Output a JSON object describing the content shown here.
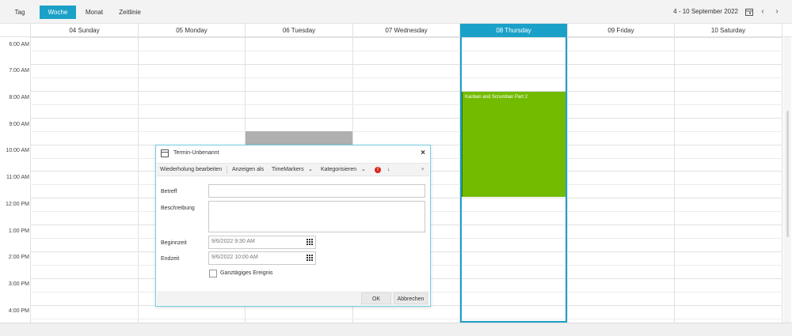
{
  "toolbar": {
    "views": [
      {
        "label": "Tag",
        "active": false
      },
      {
        "label": "Woche",
        "active": true
      },
      {
        "label": "Monat",
        "active": false
      },
      {
        "label": "Zeitlinie",
        "active": false
      }
    ],
    "date_range": "4 - 10 September 2022",
    "calendar_icon": "calendar-icon",
    "prev_icon": "chevron-left-icon",
    "next_icon": "chevron-right-icon",
    "prev_glyph": "‹",
    "next_glyph": "›"
  },
  "calendar": {
    "days": [
      {
        "label": "04 Sunday",
        "today": false
      },
      {
        "label": "05 Monday",
        "today": false
      },
      {
        "label": "06 Tuesday",
        "today": false
      },
      {
        "label": "07 Wednesday",
        "today": false
      },
      {
        "label": "08 Thursday",
        "today": true
      },
      {
        "label": "09 Friday",
        "today": false
      },
      {
        "label": "10 Saturday",
        "today": false
      }
    ],
    "times": [
      "6:00 AM",
      "7:00 AM",
      "8:00 AM",
      "9:00 AM",
      "10:00 AM",
      "11:00 AM",
      "12:00 PM",
      "1:00 PM",
      "2:00 PM",
      "3:00 PM",
      "4:00 PM"
    ],
    "events": [
      {
        "title": "Kanban and Scrumban Part 2",
        "day": "08 Thursday",
        "start": "8:00 AM",
        "end": "12:00 PM",
        "color": "#72bb00"
      },
      {
        "title": "",
        "day": "06 Tuesday",
        "start": "9:30 AM",
        "end": "10:00 AM",
        "color": "#b0b0b0"
      }
    ],
    "accent_color": "#1ba1c8"
  },
  "dialog": {
    "title": "Termin-Unbenannt",
    "close_glyph": "×",
    "toolbar": {
      "recurrence": "Wiederholung bearbeiten",
      "show_as": "Anzeigen als",
      "time_markers": "TimeMarkers",
      "categorize": "Kategorisieren",
      "dropdown_glyph": "⌄",
      "importance_high": "!",
      "importance_low": "↓",
      "more": "▾"
    },
    "subject_label": "Betreff",
    "subject_value": "",
    "description_label": "Beschreibung",
    "description_value": "",
    "start_label": "Beginnzeit",
    "start_value": "9/6/2022 9:30 AM",
    "end_label": "Endzeit",
    "end_value": "9/6/2022 10:00 AM",
    "all_day_label": "Ganztägiges Ereignis",
    "all_day_checked": false,
    "ok_label": "OK",
    "cancel_label": "Abbrechen"
  }
}
